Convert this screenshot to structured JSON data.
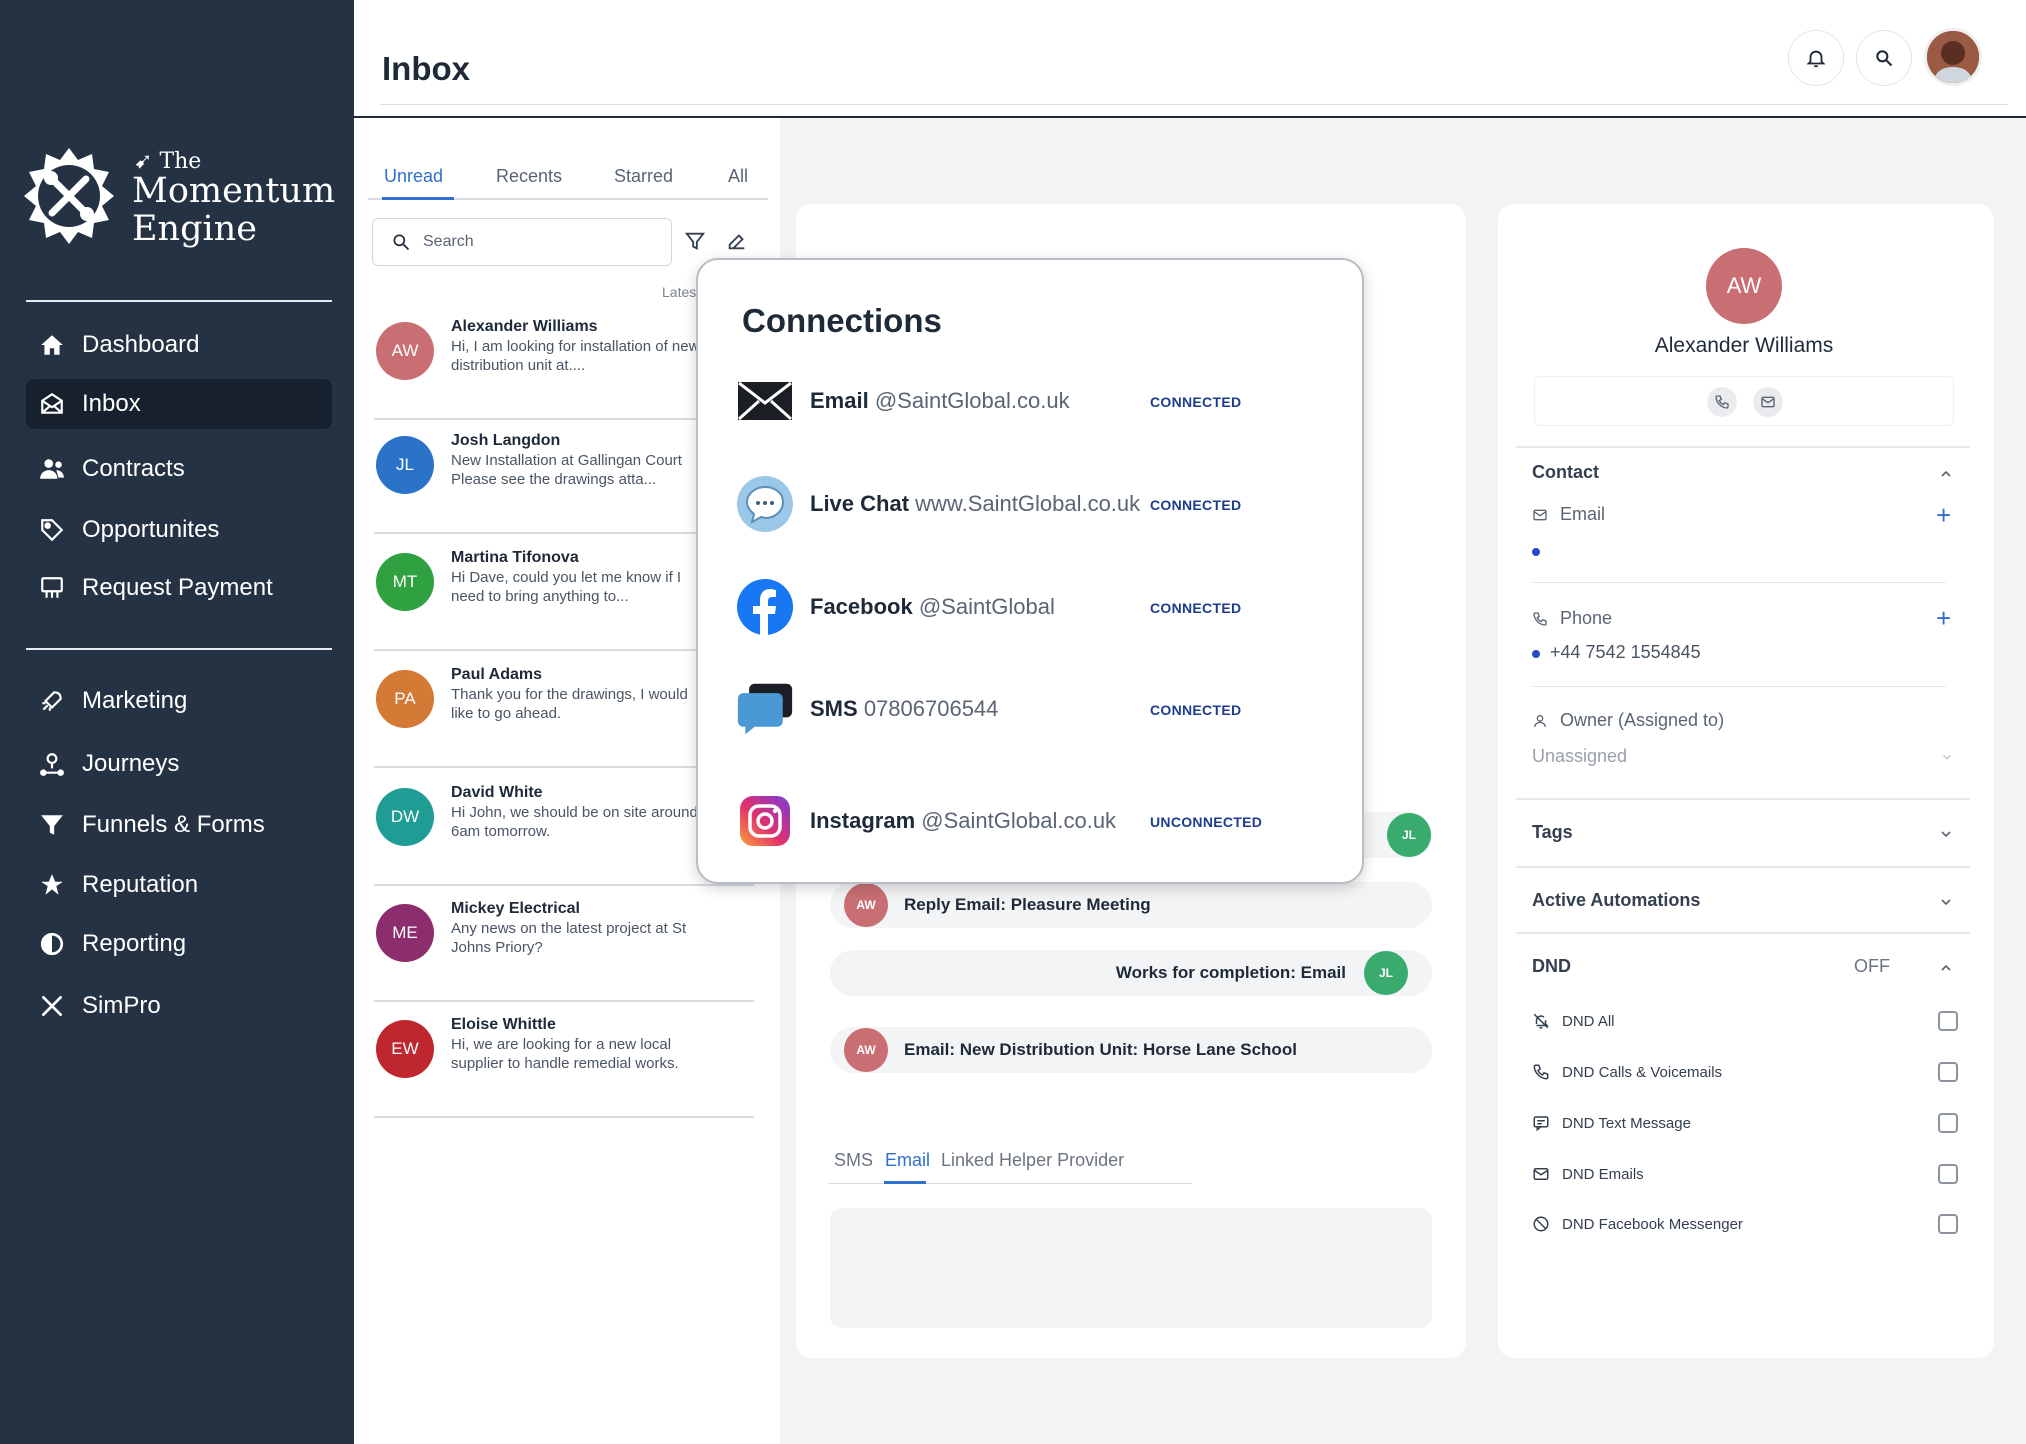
{
  "brand": {
    "line1": "The",
    "line2": "Momentum",
    "line3": "Engine"
  },
  "nav": {
    "items": [
      {
        "label": "Dashboard",
        "icon": "home-icon"
      },
      {
        "label": "Inbox",
        "icon": "inbox-icon",
        "active": true
      },
      {
        "label": "Contracts",
        "icon": "contacts-icon"
      },
      {
        "label": "Opportunites",
        "icon": "tag-icon"
      },
      {
        "label": "Request Payment",
        "icon": "payment-icon"
      },
      {
        "label": "Marketing",
        "icon": "rocket-icon"
      },
      {
        "label": "Journeys",
        "icon": "journey-icon"
      },
      {
        "label": "Funnels & Forms",
        "icon": "funnel-icon"
      },
      {
        "label": "Reputation",
        "icon": "star-icon"
      },
      {
        "label": "Reporting",
        "icon": "pie-icon"
      },
      {
        "label": "SimPro",
        "icon": "tools-icon"
      }
    ]
  },
  "header": {
    "title": "Inbox"
  },
  "inbox": {
    "tabs": [
      "Unread",
      "Recents",
      "Starred",
      "All"
    ],
    "search_placeholder": "Search",
    "sort_label": "Latest",
    "conversations": [
      {
        "initials": "AW",
        "color": "#c96f73",
        "name": "Alexander Williams",
        "preview": "Hi, I am looking for installation of new distribution unit at...."
      },
      {
        "initials": "JL",
        "color": "#2b73c9",
        "name": "Josh Langdon",
        "preview": "New Installation at Gallingan Court Please see the drawings atta..."
      },
      {
        "initials": "MT",
        "color": "#2fa140",
        "name": "Martina Tifonova",
        "preview": "Hi Dave, could you let me know if I need to bring anything to..."
      },
      {
        "initials": "PA",
        "color": "#d27a36",
        "name": "Paul Adams",
        "preview": "Thank you for the drawings, I would like to go ahead."
      },
      {
        "initials": "DW",
        "color": "#1f9c94",
        "name": "David White",
        "preview": "Hi John, we should be on site around 6am tomorrow."
      },
      {
        "initials": "ME",
        "color": "#8c2d6e",
        "name": "Mickey Electrical",
        "preview": "Any news on the latest project at St Johns Priory?"
      },
      {
        "initials": "EW",
        "color": "#c0262e",
        "name": "Eloise Whittle",
        "preview": "Hi, we are looking for a new local supplier to handle remedial works."
      }
    ]
  },
  "thread": {
    "messages": [
      {
        "initials": "JL",
        "color": "#3aab6f",
        "text": "",
        "side": "right"
      },
      {
        "initials": "AW",
        "color": "#c96f73",
        "text": "Reply Email: Pleasure Meeting",
        "side": "left"
      },
      {
        "initials": "JL",
        "color": "#3aab6f",
        "text": "Works for completion: Email",
        "side": "right"
      },
      {
        "initials": "AW",
        "color": "#c96f73",
        "text": "Email: New Distribution Unit: Horse Lane School",
        "side": "left"
      }
    ],
    "composer_tabs": [
      "SMS",
      "Email",
      "Linked Helper Provider"
    ]
  },
  "connections": {
    "title": "Connections",
    "items": [
      {
        "icon": "email-icon",
        "label": "Email",
        "handle": "@SaintGlobal.co.uk",
        "status": "CONNECTED"
      },
      {
        "icon": "live-chat-icon",
        "label": "Live Chat",
        "handle": "www.SaintGlobal.co.uk",
        "status": "CONNECTED"
      },
      {
        "icon": "facebook-icon",
        "label": "Facebook",
        "handle": "@SaintGlobal",
        "status": "CONNECTED"
      },
      {
        "icon": "sms-icon",
        "label": "SMS",
        "handle": "07806706544",
        "status": "CONNECTED"
      },
      {
        "icon": "instagram-icon",
        "label": "Instagram",
        "handle": "@SaintGlobal.co.uk",
        "status": "UNCONNECTED"
      }
    ]
  },
  "contact": {
    "initials": "AW",
    "name": "Alexander Williams",
    "section_contact": "Contact",
    "email_label": "Email",
    "phone_label": "Phone",
    "phone_value": "+44 7542 1554845",
    "owner_label": "Owner (Assigned to)",
    "owner_value": "Unassigned",
    "tags_label": "Tags",
    "automations_label": "Active Automations",
    "dnd_label": "DND",
    "dnd_state": "OFF",
    "dnd_items": [
      "DND All",
      "DND Calls & Voicemails",
      "DND Text Message",
      "DND Emails",
      "DND Facebook Messenger"
    ]
  }
}
